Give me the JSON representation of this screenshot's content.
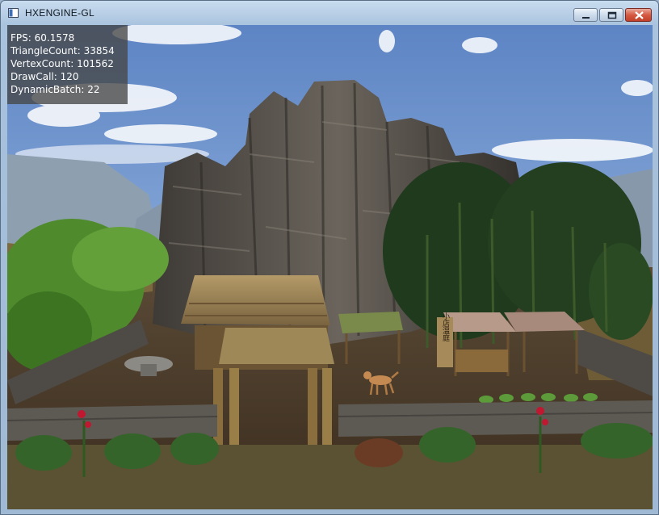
{
  "window": {
    "title": "HXENGINE-GL",
    "controls": {
      "minimize": "minimize-icon",
      "maximize": "maximize-icon",
      "close": "close-icon"
    }
  },
  "stats": {
    "fps": "FPS: 60.1578",
    "triangles": "TriangleCount: 33854",
    "vertices": "VertexCount: 101562",
    "drawcalls": "DrawCall: 120",
    "batches": "DynamicBatch: 22"
  },
  "scene": {
    "sign_text": "小店温庭",
    "colors": {
      "sky": "#6e90c8",
      "ground": "#4a3b2a",
      "rock": "#4d4944",
      "bamboo": "#1f3a1c",
      "thatch": "#a08a5a"
    }
  }
}
